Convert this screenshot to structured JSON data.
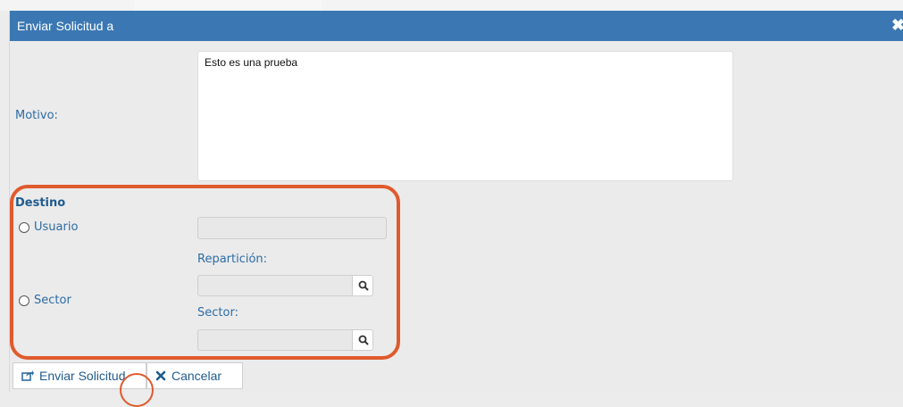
{
  "dialog": {
    "title": "Enviar Solicitud a",
    "close_icon": "close-icon"
  },
  "form": {
    "motivo_label": "Motivo:",
    "motivo_value": "Esto es una prueba",
    "destino_heading": "Destino",
    "usuario_label": "Usuario",
    "sector_label": "Sector",
    "reparticion_label": "Repartición:",
    "sector_field_label": "Sector:"
  },
  "buttons": {
    "send_label": "Enviar Solicitud",
    "cancel_label": "Cancelar"
  },
  "colors": {
    "titlebar": "#3b78b3",
    "highlight": "#e05a2d",
    "label": "#2d6ca5"
  }
}
